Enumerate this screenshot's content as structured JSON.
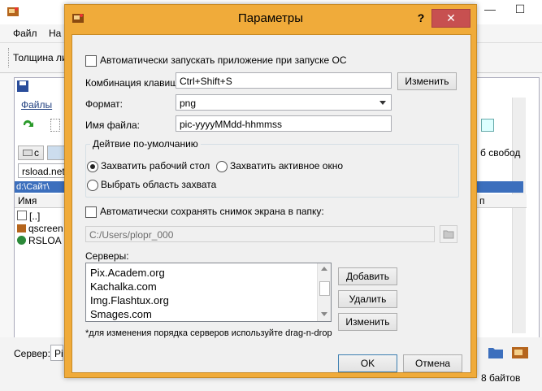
{
  "background": {
    "menu_items": [
      "Файл",
      "На"
    ],
    "toolbar_label": "Толщина ли",
    "inner_menu": "Файлы",
    "tab1": "с",
    "address_bar": "rsload.net.",
    "path": "d:\\Сайт\\",
    "col_name": "Имя",
    "col_right": "п",
    "files": [
      "[..]",
      "qscreen",
      "RSLOA"
    ],
    "free_label": "б свобод",
    "server_label": "Сервер:",
    "server_value": "Pi",
    "bytes_label": "8 байтов"
  },
  "dialog": {
    "title": "Параметры",
    "help_label": "?",
    "close_label": "✕",
    "autostart_label": "Автоматически запускать приложение при запуске ОС",
    "hotkey_label": "Комбинация клавиш:",
    "hotkey_value": "Ctrl+Shift+S",
    "hotkey_change": "Изменить",
    "format_label": "Формат:",
    "format_value": "png",
    "filename_label": "Имя файла:",
    "filename_value": "pic-yyyyMMdd-hhmmss",
    "default_action_title": "Дейтвие по-умолчанию",
    "radio_desktop": "Захватить рабочий стол",
    "radio_window": "Захватить активное окно",
    "radio_area": "Выбрать область захвата",
    "autosave_label": "Автоматически сохранять снимок экрана в папку:",
    "autosave_path": "C:/Users/plopr_000",
    "servers_label": "Серверы:",
    "servers": [
      "Pix.Academ.org",
      "Kachalka.com",
      "Img.Flashtux.org",
      "Smages.com"
    ],
    "add_button": "Добавить",
    "delete_button": "Удалить",
    "edit_button": "Изменить",
    "hint": "*для изменения порядка серверов используйте drag-n-drop",
    "ok_button": "OK",
    "cancel_button": "Отмена"
  }
}
